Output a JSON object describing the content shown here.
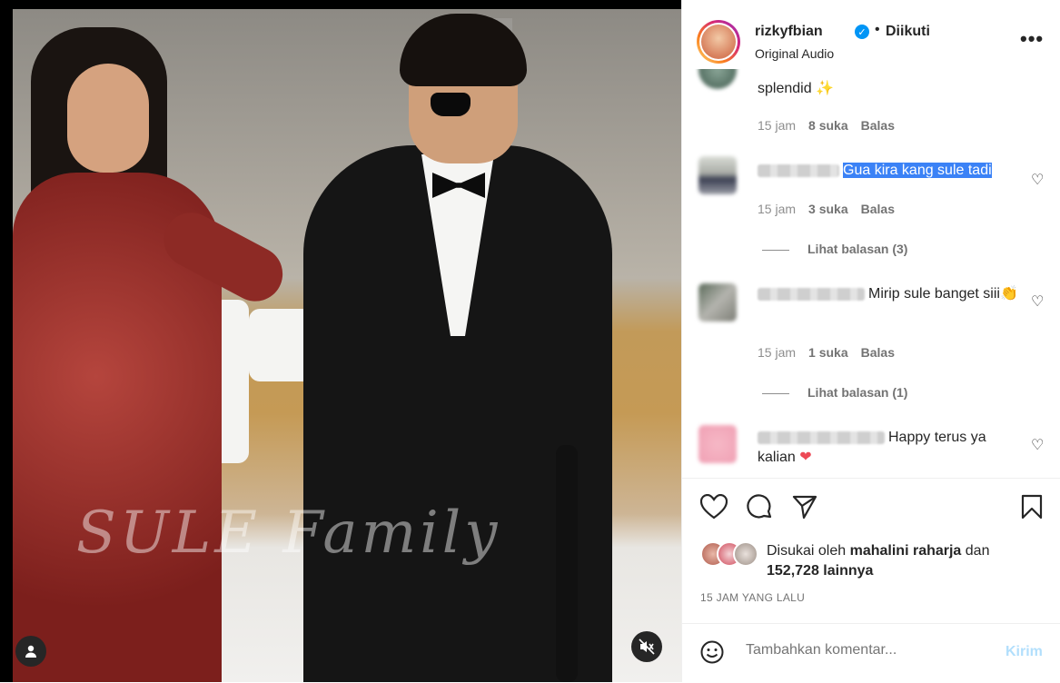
{
  "post": {
    "username": "rizkyfbian",
    "follow_status": "Diikuti",
    "separator": "•",
    "audio": "Original Audio",
    "more": "•••"
  },
  "media": {
    "watermark": "SULE Family",
    "sound": "muted"
  },
  "comments": [
    {
      "text": "splendid",
      "emoji": "✨",
      "time": "15 jam",
      "likes": "8 suka",
      "reply": "Balas"
    },
    {
      "text": "Gua kira kang sule tadi",
      "time": "15 jam",
      "likes": "3 suka",
      "reply": "Balas",
      "view_replies": "Lihat balasan (3)",
      "selected": true
    },
    {
      "text": "Mirip sule banget siii",
      "emoji": "👏",
      "time": "15 jam",
      "likes": "1 suka",
      "reply": "Balas",
      "view_replies": "Lihat balasan (1)"
    },
    {
      "text": "Happy terus ya kalian",
      "emoji": "❤"
    }
  ],
  "likes": {
    "prefix": "Disukai oleh",
    "user": "mahalini raharja",
    "and": "dan",
    "count": "152,728 lainnya"
  },
  "timestamp": "15 JAM YANG LALU",
  "add_comment": {
    "placeholder": "Tambahkan komentar...",
    "post_label": "Kirim"
  },
  "colors": {
    "accent": "#0095f6",
    "post_disabled": "#b2dffc",
    "heart_red": "#ed4956"
  }
}
